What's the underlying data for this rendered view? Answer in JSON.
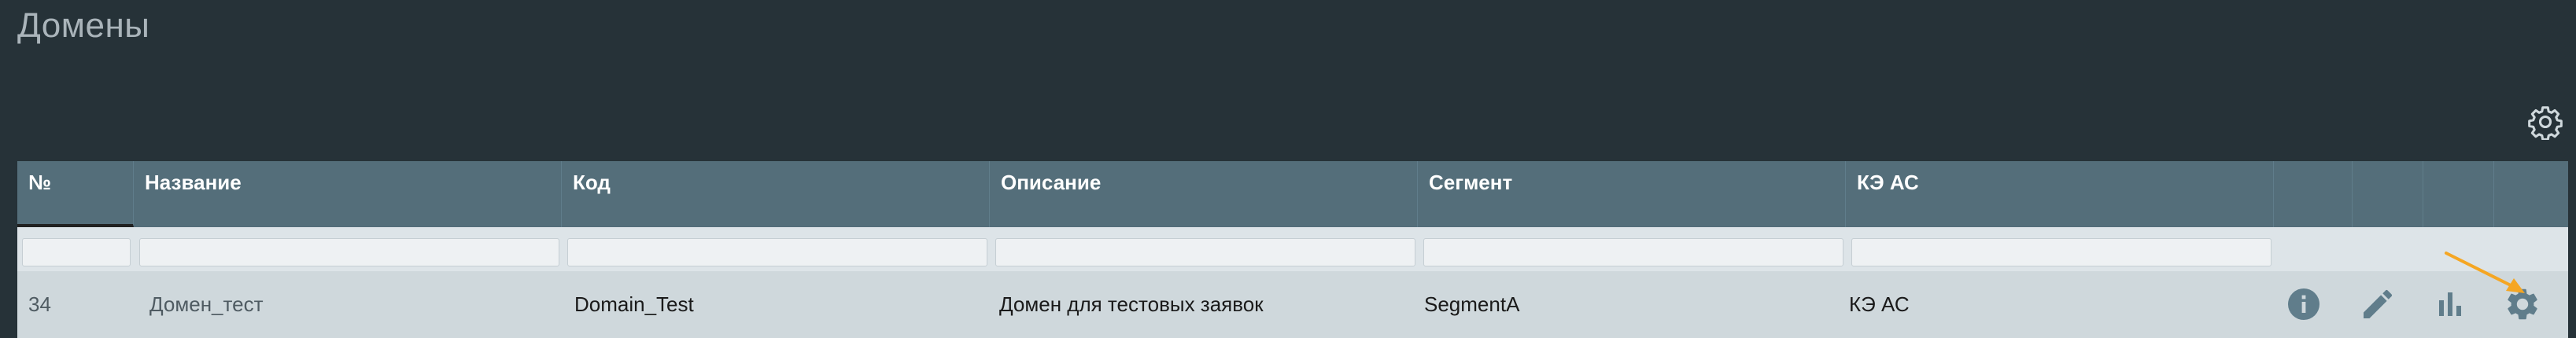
{
  "page": {
    "title": "Домены"
  },
  "colors": {
    "accent_arrow": "#f5a623",
    "icon_gray": "#607d8b",
    "header_bg": "#546e7a"
  },
  "table": {
    "columns": [
      {
        "key": "num",
        "label": "№"
      },
      {
        "key": "name",
        "label": "Название"
      },
      {
        "key": "code",
        "label": "Код"
      },
      {
        "key": "description",
        "label": "Описание"
      },
      {
        "key": "segment",
        "label": "Сегмент"
      },
      {
        "key": "ke_as",
        "label": "КЭ АС"
      }
    ],
    "filters": [
      {
        "key": "num",
        "value": "",
        "placeholder": ""
      },
      {
        "key": "name",
        "value": "",
        "placeholder": ""
      },
      {
        "key": "code",
        "value": "",
        "placeholder": ""
      },
      {
        "key": "description",
        "value": "",
        "placeholder": ""
      },
      {
        "key": "segment",
        "value": "",
        "placeholder": ""
      },
      {
        "key": "ke_as",
        "value": "",
        "placeholder": ""
      }
    ],
    "rows": [
      {
        "num": "34",
        "name": "Домен_тест",
        "code": "Domain_Test",
        "description": "Домен для тестовых заявок",
        "segment": "SegmentA",
        "ke_as": "КЭ АС",
        "actions": [
          "info-icon",
          "edit-icon",
          "chart-icon",
          "settings-icon"
        ]
      }
    ]
  },
  "toolbar": {
    "settings_icon": "settings-icon"
  }
}
